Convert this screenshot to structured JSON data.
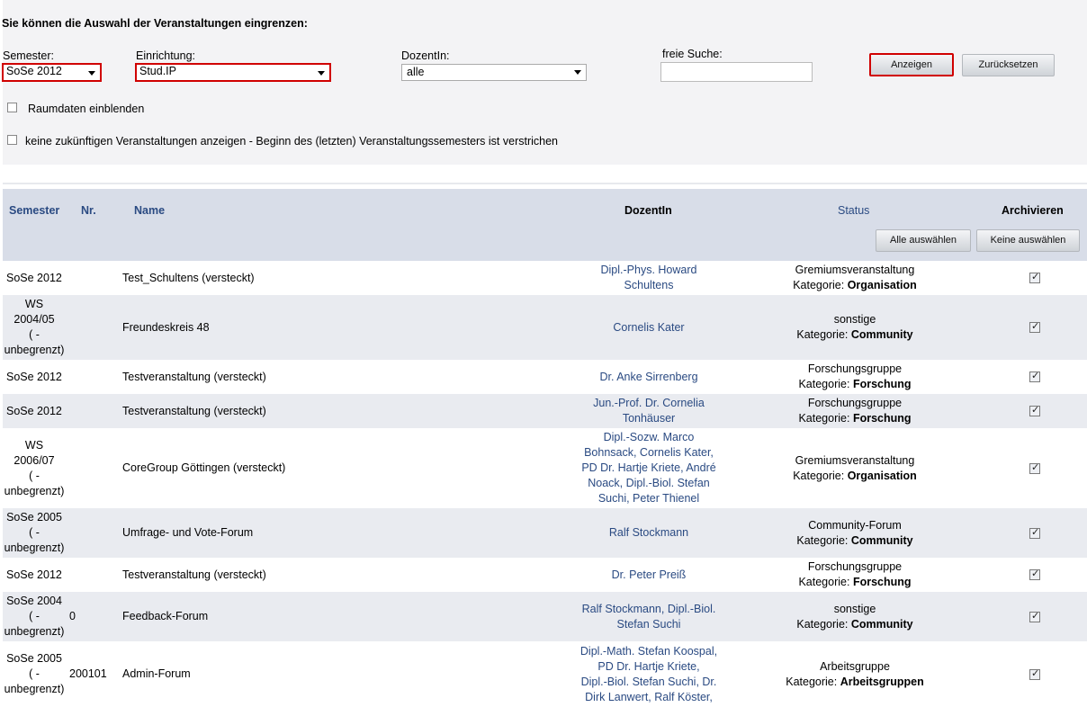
{
  "filter": {
    "heading": "Sie können die Auswahl der Veranstaltungen eingrenzen:",
    "semester_label": "Semester:",
    "semester_value": "SoSe 2012",
    "einrichtung_label": "Einrichtung:",
    "einrichtung_value": "Stud.IP",
    "dozent_label": "DozentIn:",
    "dozent_value": "alle",
    "search_label": "freie Suche:",
    "search_value": "",
    "show_button": "Anzeigen",
    "reset_button": "Zurücksetzen",
    "room_checkbox": "Raumdaten einblenden",
    "future_checkbox": "keine zukünftigen Veranstaltungen anzeigen - Beginn des (letzten) Veranstaltungssemesters ist verstrichen"
  },
  "table": {
    "headers": {
      "semester": "Semester",
      "nr": "Nr.",
      "name": "Name",
      "dozent": "DozentIn",
      "status": "Status",
      "archive": "Archivieren"
    },
    "select_all": "Alle auswählen",
    "select_none": "Keine auswählen",
    "rows": [
      {
        "semester": [
          "SoSe 2012"
        ],
        "nr": "",
        "name": "Test_Schultens (versteckt)",
        "dozent": [
          "Dipl.-Phys. Howard",
          "Schultens"
        ],
        "status": "Gremiumsveranstaltung",
        "kategorie_label": "Kategorie: ",
        "kategorie": "Organisation",
        "checked": true
      },
      {
        "semester": [
          "WS",
          "2004/05",
          "( -",
          "unbegrenzt)"
        ],
        "nr": "",
        "name": "Freundeskreis 48",
        "dozent": [
          "Cornelis Kater"
        ],
        "status": "sonstige",
        "kategorie_label": "Kategorie: ",
        "kategorie": "Community",
        "checked": true
      },
      {
        "semester": [
          "SoSe 2012"
        ],
        "nr": "",
        "name": "Testveranstaltung (versteckt)",
        "dozent": [
          "Dr. Anke Sirrenberg"
        ],
        "status": "Forschungsgruppe",
        "kategorie_label": "Kategorie: ",
        "kategorie": "Forschung",
        "checked": true
      },
      {
        "semester": [
          "SoSe 2012"
        ],
        "nr": "",
        "name": "Testveranstaltung (versteckt)",
        "dozent": [
          "Jun.-Prof. Dr. Cornelia",
          "Tonhäuser"
        ],
        "status": "Forschungsgruppe",
        "kategorie_label": "Kategorie: ",
        "kategorie": "Forschung",
        "checked": true
      },
      {
        "semester": [
          "WS",
          "2006/07",
          "( -",
          "unbegrenzt)"
        ],
        "nr": "",
        "name": "CoreGroup Göttingen (versteckt)",
        "dozent": [
          "Dipl.-Sozw. Marco",
          "Bohnsack, Cornelis Kater,",
          "PD Dr. Hartje Kriete, André",
          "Noack, Dipl.-Biol. Stefan",
          "Suchi, Peter Thienel"
        ],
        "status": "Gremiumsveranstaltung",
        "kategorie_label": "Kategorie: ",
        "kategorie": "Organisation",
        "checked": true
      },
      {
        "semester": [
          "SoSe 2005",
          "( -",
          "unbegrenzt)"
        ],
        "nr": "",
        "name": "Umfrage- und Vote-Forum",
        "dozent": [
          "Ralf Stockmann"
        ],
        "status": "Community-Forum",
        "kategorie_label": "Kategorie: ",
        "kategorie": "Community",
        "checked": true
      },
      {
        "semester": [
          "SoSe 2012"
        ],
        "nr": "",
        "name": "Testveranstaltung (versteckt)",
        "dozent": [
          "Dr. Peter Preiß"
        ],
        "status": "Forschungsgruppe",
        "kategorie_label": "Kategorie: ",
        "kategorie": "Forschung",
        "checked": true
      },
      {
        "semester": [
          "SoSe 2004",
          "( -",
          "unbegrenzt)"
        ],
        "nr": "0",
        "name": "Feedback-Forum",
        "dozent": [
          "Ralf Stockmann, Dipl.-Biol.",
          "Stefan Suchi"
        ],
        "status": "sonstige",
        "kategorie_label": "Kategorie: ",
        "kategorie": "Community",
        "checked": true
      },
      {
        "semester": [
          "SoSe 2005",
          "( -",
          "unbegrenzt)"
        ],
        "nr": "200101",
        "name": "Admin-Forum",
        "dozent": [
          "Dipl.-Math. Stefan Koospal,",
          "PD Dr. Hartje Kriete,",
          "Dipl.-Biol. Stefan Suchi, Dr.",
          "Dirk Lanwert, Ralf Köster,"
        ],
        "status": "Arbeitsgruppe",
        "kategorie_label": "Kategorie: ",
        "kategorie": "Arbeitsgruppen",
        "checked": true
      }
    ]
  }
}
